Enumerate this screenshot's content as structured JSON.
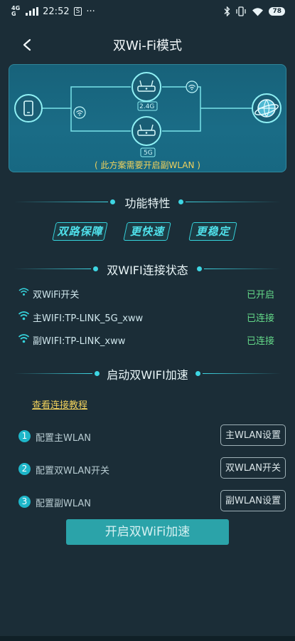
{
  "status_bar": {
    "network": "4G",
    "network_sub": "G",
    "time": "22:52",
    "notif_badge": "S",
    "more": "···",
    "battery": "78"
  },
  "header": {
    "back_icon": "chevron-left-icon",
    "title": "双Wi-Fi模式"
  },
  "diagram": {
    "band_24": "2.4G",
    "band_5": "5G",
    "note": "( 此方案需要开启副WLAN )"
  },
  "features": {
    "title": "功能特性",
    "items": [
      "双路保障",
      "更快速",
      "更稳定"
    ]
  },
  "connection": {
    "title": "双WIFI连接状态",
    "rows": [
      {
        "icon": "wifi-outline-icon",
        "label": "双WiFi开关",
        "state": "已开启"
      },
      {
        "icon": "wifi-icon",
        "label": "主WIFI:TP-LINK_5G_xww",
        "state": "已连接"
      },
      {
        "icon": "wifi-icon",
        "label": "副WIFI:TP-LINK_xww",
        "state": "已连接"
      }
    ]
  },
  "acceleration": {
    "title": "启动双WIFI加速",
    "tutorial_link": "查看连接教程",
    "steps": [
      {
        "num": "1",
        "text": "配置主WLAN",
        "button": "主WLAN设置"
      },
      {
        "num": "2",
        "text": "配置双WLAN开关",
        "button": "双WLAN开关"
      },
      {
        "num": "3",
        "text": "配置副WLAN",
        "button": "副WLAN设置"
      }
    ],
    "main_button": "开启双WiFi加速"
  },
  "colors": {
    "background": "#1b2d37",
    "accent": "#35d3dc",
    "status_ok": "#64d989",
    "highlight": "#f0d15c",
    "primary_button": "#2ba3a9"
  }
}
